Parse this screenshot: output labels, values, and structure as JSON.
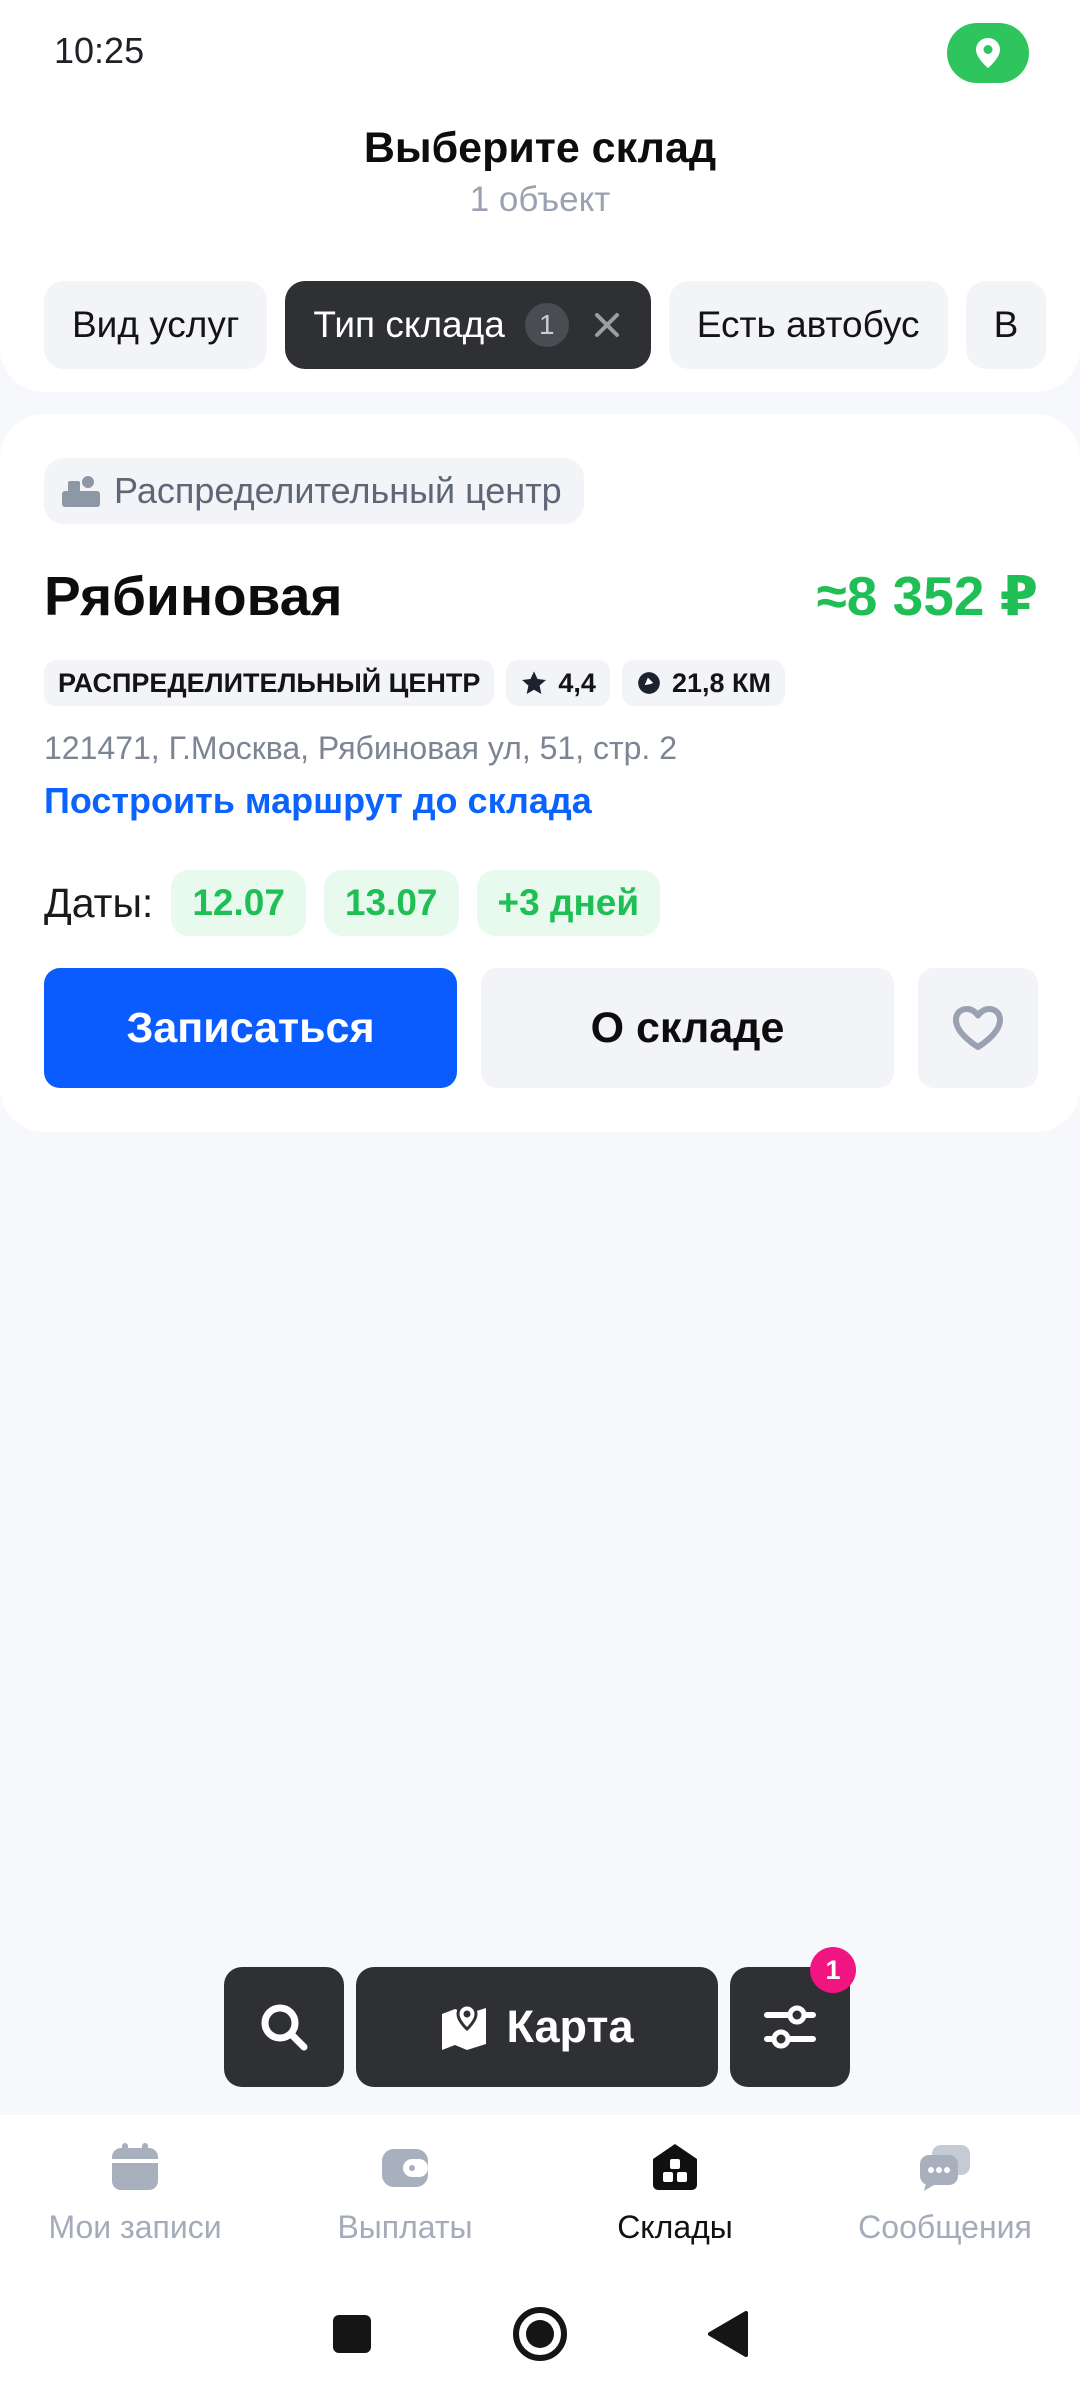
{
  "status_bar": {
    "time": "10:25"
  },
  "header": {
    "title": "Выберите склад",
    "subtitle": "1 объект"
  },
  "filters": [
    {
      "label": "Вид услуг"
    },
    {
      "label": "Тип склада",
      "count": "1",
      "active": true
    },
    {
      "label": "Есть автобус"
    },
    {
      "label": "В"
    }
  ],
  "card": {
    "type_tag": "Распределительный центр",
    "name": "Рябиновая",
    "price": "≈8 352 ₽",
    "badges": {
      "type": "РАСПРЕДЕЛИТЕЛЬНЫЙ ЦЕНТР",
      "rating": "4,4",
      "distance": "21,8 КМ"
    },
    "address": "121471, Г.Москва, Рябиновая ул, 51, стр. 2",
    "route_link": "Построить маршрут до склада",
    "dates_label": "Даты:",
    "dates": [
      "12.07",
      "13.07",
      "+3 дней"
    ],
    "primary_button": "Записаться",
    "secondary_button": "О складе"
  },
  "float_bar": {
    "map_label": "Карта",
    "filter_badge": "1"
  },
  "bottom_nav": [
    {
      "label": "Мои записи",
      "icon": "calendar-icon"
    },
    {
      "label": "Выплаты",
      "icon": "wallet-icon"
    },
    {
      "label": "Склады",
      "icon": "warehouse-icon",
      "active": true
    },
    {
      "label": "Сообщения",
      "icon": "chat-icon"
    }
  ],
  "colors": {
    "accent_blue": "#0a5cff",
    "price_green": "#1fbf55",
    "dark_chip": "#2f3033",
    "badge_pink": "#f01580",
    "location_green": "#2ec55e"
  }
}
